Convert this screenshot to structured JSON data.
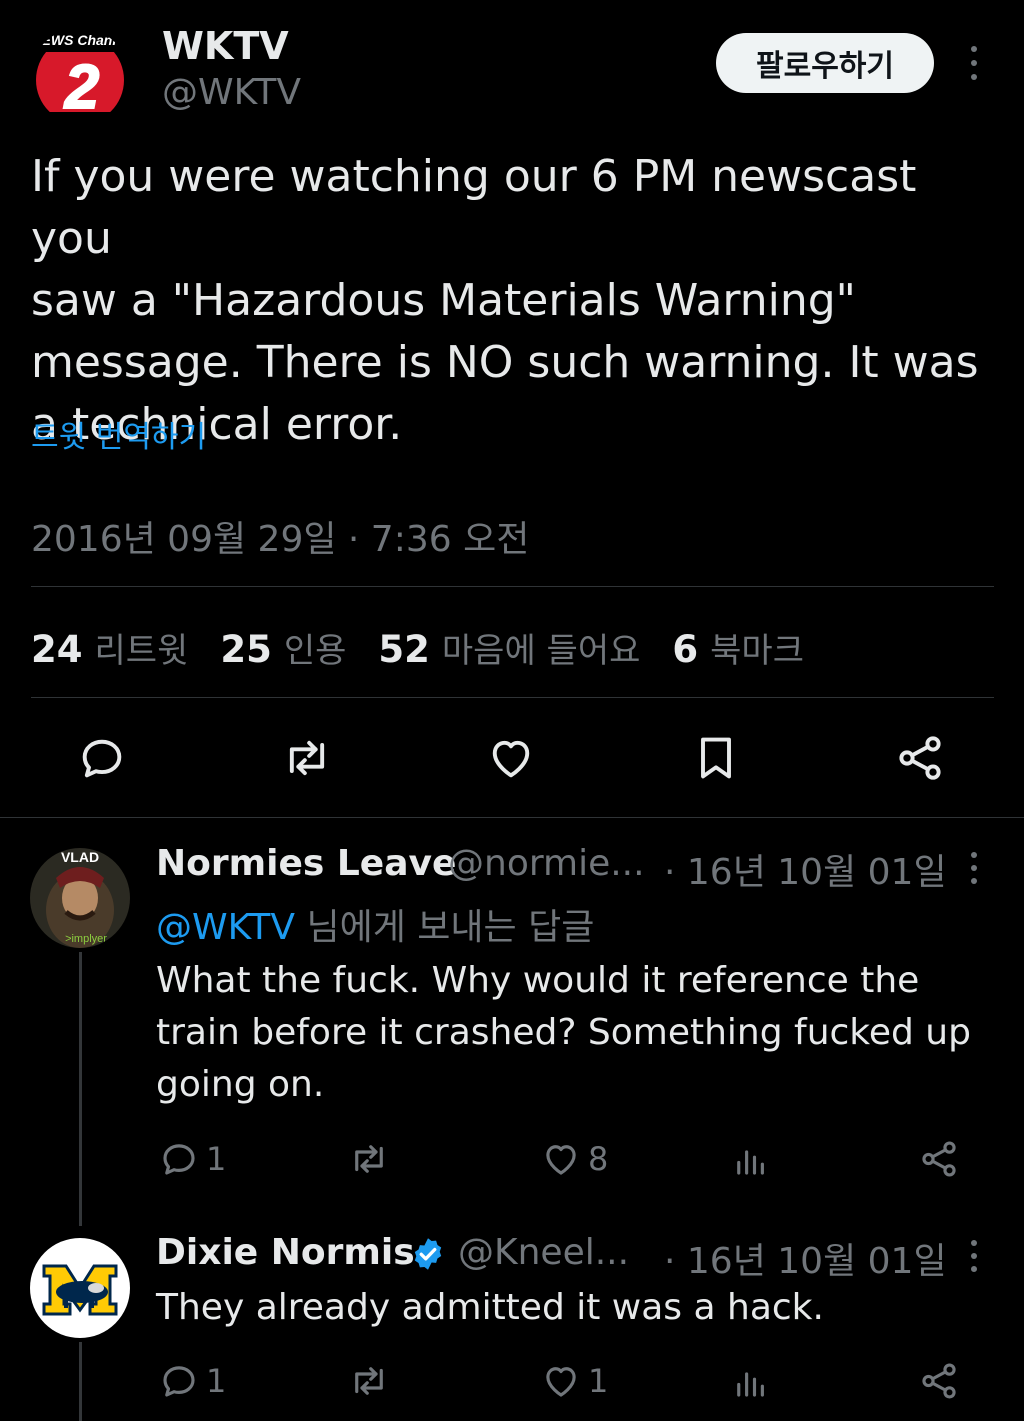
{
  "main_tweet": {
    "avatar_text_top": "NEWS Channel",
    "avatar_numeral": "2",
    "display_name": "WKTV",
    "handle": "@WKTV",
    "follow_label": "팔로우하기",
    "text_lines": [
      "If you were watching our 6 PM newscast you",
      "saw a \"Hazardous Materials Warning\"",
      "message. There is NO such warning. It was",
      "a technical error."
    ],
    "translate_label": "트윗 번역하기",
    "timestamp": "2016년 09월 29일 · 7:36 오전",
    "stats": [
      {
        "count": "24",
        "label": "리트윗"
      },
      {
        "count": "25",
        "label": "인용"
      },
      {
        "count": "52",
        "label": "마음에 들어요"
      },
      {
        "count": "6",
        "label": "북마크"
      }
    ],
    "actions": [
      "reply-icon",
      "retweet-icon",
      "like-icon",
      "bookmark-icon",
      "share-icon"
    ]
  },
  "replies": [
    {
      "avatar_label_top": "VLAD",
      "avatar_label_bottom": ">implyer",
      "display_name": "Normies Leave",
      "handle": "@normie...",
      "date": "· 16년 10월 01일",
      "replying_to_mention": "@WKTV",
      "replying_to_suffix": " 님에게 보내는 답글",
      "text_lines": [
        "What the fuck. Why would it reference the",
        "train before it crashed? Something fucked up",
        "going on."
      ],
      "reply_count": "1",
      "retweet_count": "",
      "like_count": "8"
    },
    {
      "display_name": "Dixie Normis",
      "verified": true,
      "handle": "@Kneel...",
      "date": "· 16년 10월 01일",
      "text_lines": [
        "They already admitted it was a hack."
      ],
      "reply_count": "1",
      "retweet_count": "",
      "like_count": "1"
    }
  ],
  "colors": {
    "background": "#000000",
    "text": "#e7e9ea",
    "muted": "#71767b",
    "link": "#1d9bf0",
    "divider": "#2f3336",
    "logo_red": "#d7192a",
    "verified": "#1d9bf0",
    "michigan_blue": "#00274c",
    "michigan_maize": "#ffcb05"
  }
}
